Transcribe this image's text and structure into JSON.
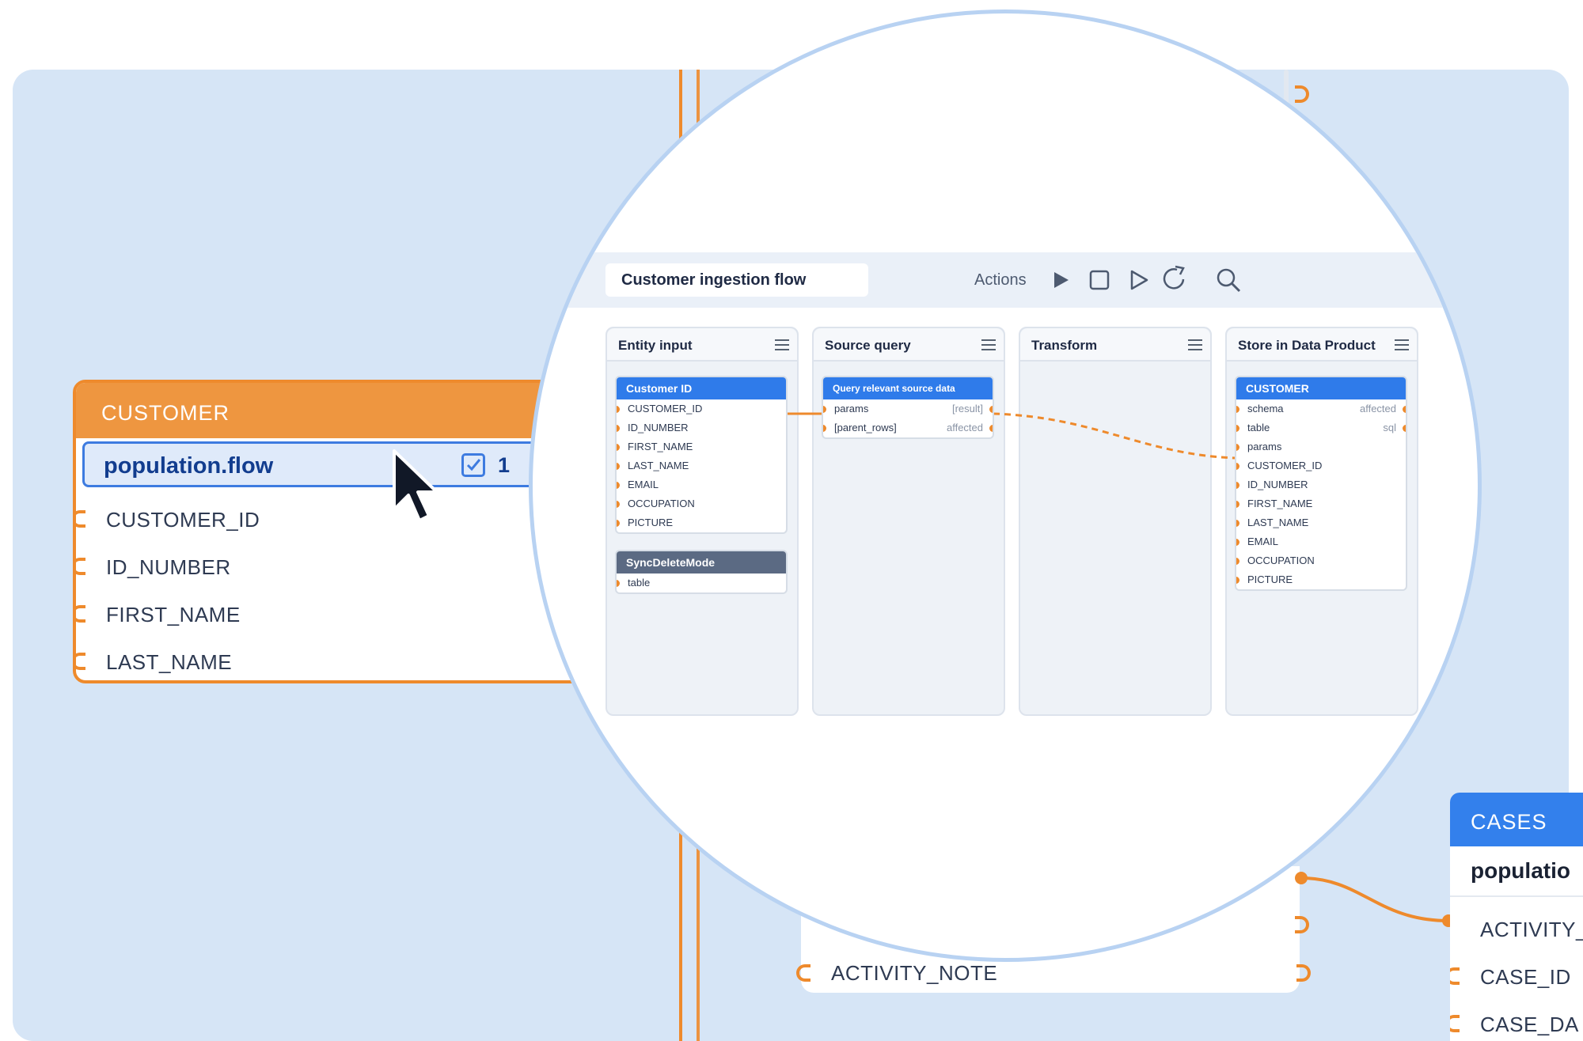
{
  "customer_card": {
    "title": "CUSTOMER",
    "flow_name": "population.flow",
    "flow_count": "1",
    "fields": [
      "CUSTOMER_ID",
      "ID_NUMBER",
      "FIRST_NAME",
      "LAST_NAME"
    ]
  },
  "middle_card": {
    "field": "ACTIVITY_NOTE"
  },
  "cases_card": {
    "title": "CASES",
    "flow_name": "populatio",
    "fields": [
      "ACTIVITY_",
      "CASE_ID",
      "CASE_DA"
    ]
  },
  "zoom": {
    "flow_title": "Customer ingestion flow",
    "actions_label": "Actions",
    "icons": [
      "play-filled-icon",
      "stop-icon",
      "play-outline-icon",
      "rerun-icon",
      "search-icon"
    ],
    "columns": [
      {
        "title": "Entity input"
      },
      {
        "title": "Source query"
      },
      {
        "title": "Transform"
      },
      {
        "title": "Store in Data Product"
      }
    ],
    "nodes": {
      "customer_id": {
        "title": "Customer ID",
        "ports": [
          "CUSTOMER_ID",
          "ID_NUMBER",
          "FIRST_NAME",
          "LAST_NAME",
          "EMAIL",
          "OCCUPATION",
          "PICTURE"
        ]
      },
      "sync_delete": {
        "title": "SyncDeleteMode",
        "ports": [
          "table"
        ]
      },
      "query": {
        "title": "Query relevant source data",
        "ports": [
          {
            "left": "params",
            "right": "[result]"
          },
          {
            "left": "[parent_rows]",
            "right": "affected"
          }
        ]
      },
      "store_customer": {
        "title": "CUSTOMER",
        "ports": [
          {
            "left": "schema",
            "right": "affected"
          },
          {
            "left": "table",
            "right": "sql"
          },
          {
            "left": "params",
            "right": ""
          },
          {
            "left": "CUSTOMER_ID",
            "right": ""
          },
          {
            "left": "ID_NUMBER",
            "right": ""
          },
          {
            "left": "FIRST_NAME",
            "right": ""
          },
          {
            "left": "LAST_NAME",
            "right": ""
          },
          {
            "left": "EMAIL",
            "right": ""
          },
          {
            "left": "OCCUPATION",
            "right": ""
          },
          {
            "left": "PICTURE",
            "right": ""
          }
        ]
      }
    }
  },
  "colors": {
    "accent": "#ee8a2c",
    "primary": "#2f7bea",
    "canvas": "#d6e5f6"
  }
}
